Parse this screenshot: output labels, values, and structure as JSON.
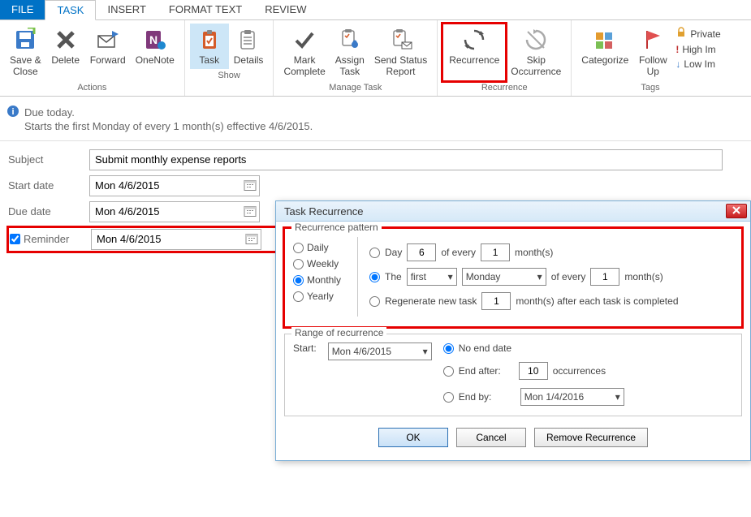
{
  "tabs": {
    "file": "FILE",
    "task": "TASK",
    "insert": "INSERT",
    "format": "FORMAT TEXT",
    "review": "REVIEW"
  },
  "ribbon": {
    "actions": {
      "label": "Actions",
      "save": "Save &\nClose",
      "delete": "Delete",
      "forward": "Forward",
      "onenote": "OneNote"
    },
    "show": {
      "label": "Show",
      "task": "Task",
      "details": "Details"
    },
    "manage": {
      "label": "Manage Task",
      "mark": "Mark\nComplete",
      "assign": "Assign\nTask",
      "send": "Send Status\nReport"
    },
    "recur": {
      "label": "Recurrence",
      "recurrence": "Recurrence",
      "skip": "Skip\nOccurrence"
    },
    "tags": {
      "label": "Tags",
      "categorize": "Categorize",
      "followup": "Follow\nUp",
      "private": "Private",
      "high": "High Im",
      "low": "Low Im"
    }
  },
  "info": {
    "line1": "Due today.",
    "line2": "Starts the first Monday of every 1 month(s) effective 4/6/2015."
  },
  "form": {
    "subject_label": "Subject",
    "subject_value": "Submit monthly expense reports",
    "start_label": "Start date",
    "start_value": "Mon 4/6/2015",
    "due_label": "Due date",
    "due_value": "Mon 4/6/2015",
    "reminder_label": "Reminder",
    "reminder_value": "Mon 4/6/2015"
  },
  "dialog": {
    "title": "Task Recurrence",
    "pattern_legend": "Recurrence pattern",
    "freq": {
      "daily": "Daily",
      "weekly": "Weekly",
      "monthly": "Monthly",
      "yearly": "Yearly"
    },
    "opt_day": "Day",
    "opt_day_num": "6",
    "opt_day_of_every": "of every",
    "opt_day_months": "1",
    "opt_months_suffix": "month(s)",
    "opt_the": "The",
    "opt_the_ord": "first",
    "opt_the_dow": "Monday",
    "opt_the_of_every": "of every",
    "opt_the_months": "1",
    "opt_regen": "Regenerate new task",
    "opt_regen_num": "1",
    "opt_regen_suffix": "month(s) after each task is completed",
    "range_legend": "Range of recurrence",
    "range_start_label": "Start:",
    "range_start_value": "Mon 4/6/2015",
    "range_noend": "No end date",
    "range_endafter": "End after:",
    "range_endafter_num": "10",
    "range_endafter_suffix": "occurrences",
    "range_endby": "End by:",
    "range_endby_value": "Mon 1/4/2016",
    "btn_ok": "OK",
    "btn_cancel": "Cancel",
    "btn_remove": "Remove Recurrence"
  }
}
